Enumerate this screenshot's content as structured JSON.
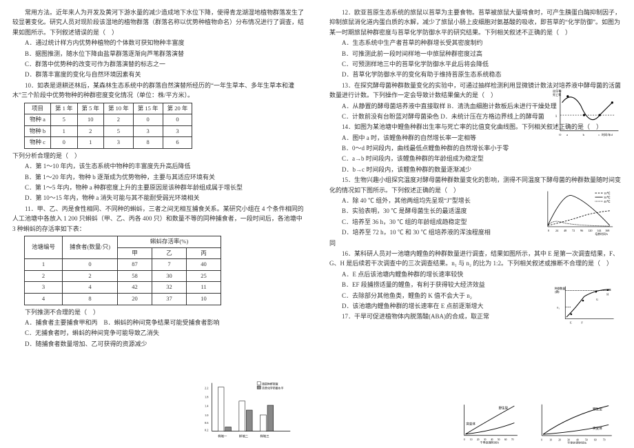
{
  "left": {
    "intro": "常用方法。近年来人为开发及黄河下游水量的减少造成地下水位下降，使得青龙湖湿地植物群落发生了较显著变化。研究人员对现阶段该湿地的植物群落（群落名称以优势种植物命名）分布情况进行了调查，结果如图所示。下列叙述错误的是（　）",
    "q9_a": "A．通过统计样方内优势种植物的个体数可获知物种丰富度",
    "q9_b": "B．据图推测，随水位下降由盐草群落逐渐向芦苇群落演替",
    "q9_c": "C．群落中优势种的改变可作为群落演替的标志之一",
    "q9_d": "D．群落丰富度的变化与自然环境因素有关",
    "q10_stem": "10．如表是退耕还林后，某森林生态系统中的群落自然演替所经历的“一年生草本、多年生草本和灌木”三个阶段中优势物种的种群密度变化情况（单位：株/平方米）。",
    "table1_head": [
      "项目",
      "第 1 年",
      "第 5 年",
      "第 10 年",
      "第 15 年",
      "第 20 年"
    ],
    "table1_rows": [
      [
        "物种 a",
        "5",
        "10",
        "2",
        "0",
        "0"
      ],
      [
        "物种 b",
        "1",
        "2",
        "5",
        "3",
        "3"
      ],
      [
        "物种 c",
        "0",
        "1",
        "3",
        "8",
        "6"
      ]
    ],
    "q10_sub": "下列分析合理的是（　）",
    "q10_a": "A．第 1～10 年内，该生态系统中物种的丰富度先升高后降低",
    "q10_b": "B．第 1～20 年内，物种 b 逐渐成为优势物种，主要与其适应环境有关",
    "q10_c": "C．第 1～5 年内，物种 a 种群密度上升的主要原因是该种群年龄组成属于增长型",
    "q10_d": "D．第 10～15 年内，物种 a 消失可能与其不能耐受弱光环境相关",
    "q11_stem": "11．甲、乙、丙是食性相同、不同种的蝌蚪，三者之间无相互捕食关系。某研究小组在 4 个条件相同的人工池塘中各放入 1 200 只蝌蚪（甲、乙、丙各 400 只）和数量不等的同种捕食者，一段时间后，各池塘中 3 种蝌蚪的存活率如下表：",
    "table2_head1": [
      "池塘编号",
      "捕食者(数量/只)",
      "蝌蚪存活率(%)"
    ],
    "table2_head2": [
      "甲",
      "乙",
      "丙"
    ],
    "table2_rows": [
      [
        "1",
        "0",
        "87",
        "7",
        "40"
      ],
      [
        "2",
        "2",
        "58",
        "30",
        "25"
      ],
      [
        "3",
        "4",
        "42",
        "32",
        "11"
      ],
      [
        "4",
        "8",
        "20",
        "37",
        "10"
      ]
    ],
    "q11_sub": "下列推测不合理的是（　）",
    "q11_a": "A．捕食者主要捕食甲和丙　B．蝌蚪的种间竞争结果可能受捕食者影响",
    "q11_c": "C．无捕食者时，蝌蚪的种间竞争可能导致乙消失",
    "q11_d": "D．随捕食者数量增加、乙可获得的资源减少"
  },
  "right": {
    "q12_stem": "12．欧亚苔原生态系统的旅鼠以苔草为主要食物。苔草被旅鼠大量啃食时，可产生胰蛋白酶抑制因子，抑制旅鼠消化道内蛋白质的水解，减少了旅鼠小肠上皮细胞对氨基酸的吸收，即苔草的“化学防御”。如图为某一时期旅鼠种群密度与苔草化学防御水平的研究结果。下列相关叙述不正确的是（　）",
    "q12_a": "A．生态系统中生产者苔草的种群增长受其密度制约",
    "q12_b": "B．可推测此前一段时间样地一中旅鼠种群密度过高",
    "q12_c": "C．可预测样地三中的苔草化学防御水平此后将会降低",
    "q12_d": "D．苔草化学防御水平的变化有助于维持苔原生态系统稳态",
    "q13_stem": "13．在探究酵母菌种群数量变化的实验中，可通过抽样检测利用显微镜计数法对培养液中酵母菌的活菌数量进行计数。下列操作一定会导致计数结果偏大的是（　）",
    "q13_a": "A．从静置的酵母菌培养液中直接取样 B．清洗血细胞计数板后未进行干燥处理",
    "q13_c": "C．计数前没有台盼蓝对酵母菌染色 D．未统计压在方格边界线上的酵母菌",
    "q14_stem": "14．如图为某池塘中鲤鱼种群出生率与死亡率的比值变化曲线图。下列相关叙述正确的是（　）",
    "q14_a": "A．图中 a 时，该鲤鱼种群的自然增长率一定相等",
    "q14_b": "B．0～d 时间段内，曲线最低点鲤鱼种群的自然增长率小于零",
    "q14_c": "C．a→b 时间段内，该鲤鱼种群的年龄组成为稳定型",
    "q14_d": "D．b→c 时间段内，该鲤鱼种群的数量逐渐减少",
    "q15_stem": "15．生物兴趣小组探究温度对酵母菌种群数量变化的影响，测得不同温度下酵母菌的种群数量随时间变化的情况如下图所示。下列叙述正确的是（　）",
    "q15_a": "A．除 40 ℃ 组外，其他两组均先呈现“J”型增长",
    "q15_b": "B．实验表明，30 ℃ 是酵母菌生长的最适温度",
    "q15_c": "C．培养至 36 h，30 ℃ 组的年龄组成趋稳定型",
    "q15_d": "D．培养至 72 h，10 ℃ 和 30 ℃ 组培养液的浑浊程度相",
    "q15_end": "同",
    "q16_stem": "16．某科研人员对一池塘内鲤鱼的种群数量进行调查，结果如图所示，其中 E 是第一次调查结果，F、G、H 是后续若干次调查中的三次调查结果。n₁ 与 n₂ 的比为 1:2。下列相关叙述或推断不合理的是（　）",
    "q16_a": "A．E 点后该池塘内鲤鱼种群的增长速率较快",
    "q16_b": "B．EF 段捕捞适量的鲤鱼，有利于获得较大经济效益",
    "q16_c": "C．去除部分其他鱼类，鲤鱼的 K 值不会大于 n₂",
    "q16_d": "D．该池塘内鲤鱼种群的增长速率在 E 点前逐渐增大",
    "q17_stem": "17．干旱可促进植物体内脱落酸(ABA)的合成，取正常"
  },
  "chart_data": [
    {
      "id": "barchart11",
      "type": "bar",
      "title": "",
      "categories": [
        "样地一",
        "样地二",
        "样地三"
      ],
      "series": [
        {
          "name": "旅鼠种群密度",
          "values": [
            2.1,
            1.4,
            0.8
          ]
        },
        {
          "name": "苔草化学防御水平",
          "values": [
            0.2,
            1.0,
            1.2
          ]
        }
      ],
      "ylim": [
        0,
        2.2
      ]
    },
    {
      "id": "curve14",
      "type": "line",
      "xlabel": "时间/年",
      "ylabel": "出生率/死亡率",
      "yref": 1,
      "x_marks": [
        "O",
        "a",
        "b",
        "c",
        "d"
      ]
    },
    {
      "id": "curve15",
      "type": "line",
      "xlabel": "培养时间/h",
      "ylabel": "",
      "x": [
        0,
        24,
        48,
        72,
        96,
        120,
        144,
        168
      ],
      "series": [
        {
          "name": "10℃",
          "approx": "low-slow-rise"
        },
        {
          "name": "30℃",
          "approx": "fast-peak-decline"
        },
        {
          "name": "40℃",
          "approx": "low-early-decline"
        }
      ]
    },
    {
      "id": "curve16",
      "type": "line",
      "xlabel": "",
      "ylabel": "种群数量(条)",
      "y_marks": [
        "n₁",
        "n₂"
      ],
      "x_points": [
        "E",
        "F",
        "G",
        "H"
      ]
    },
    {
      "id": "curve17a",
      "type": "line",
      "xlabel": "干旱处理时间/h",
      "ylabel": "胞间浓度",
      "x": [
        0,
        10,
        20,
        30,
        40,
        50,
        60,
        70
      ],
      "series": [
        {
          "name": "野生型"
        },
        {
          "name": "突变体"
        }
      ]
    },
    {
      "id": "curve17b",
      "type": "line",
      "xlabel": "干旱处理时间/h",
      "ylabel": "",
      "x": [
        0,
        10,
        20,
        30,
        40,
        50,
        60,
        70
      ],
      "series": [
        {
          "name": "野生型"
        },
        {
          "name": "突变体"
        }
      ]
    }
  ]
}
